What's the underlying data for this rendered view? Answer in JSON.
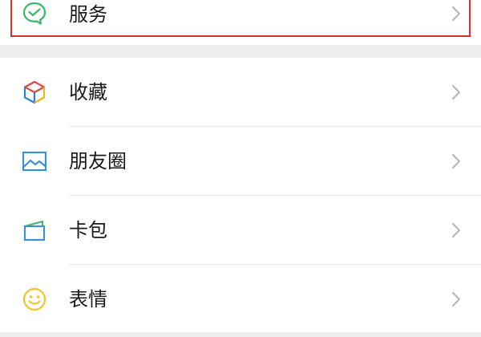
{
  "menu": {
    "top_item": {
      "label": "服务",
      "icon": "service-icon",
      "highlighted": true,
      "highlight_color": "#d9312b"
    },
    "items": [
      {
        "label": "收藏",
        "icon": "favorites-cube-icon"
      },
      {
        "label": "朋友圈",
        "icon": "moments-picture-icon"
      },
      {
        "label": "卡包",
        "icon": "card-wallet-icon"
      },
      {
        "label": "表情",
        "icon": "sticker-smiley-icon"
      }
    ]
  },
  "colors": {
    "service_green": "#3bb86a",
    "favorites_blue": "#2f7fd1",
    "favorites_red": "#e2483e",
    "favorites_yellow": "#f4b21d",
    "moments_blue": "#3d8fd8",
    "card_green": "#3bb86a",
    "card_blue": "#3d8fd8",
    "sticker_yellow": "#f5c32c",
    "text": "#191919",
    "chevron": "#b3b3b3",
    "background": "#ededed"
  }
}
